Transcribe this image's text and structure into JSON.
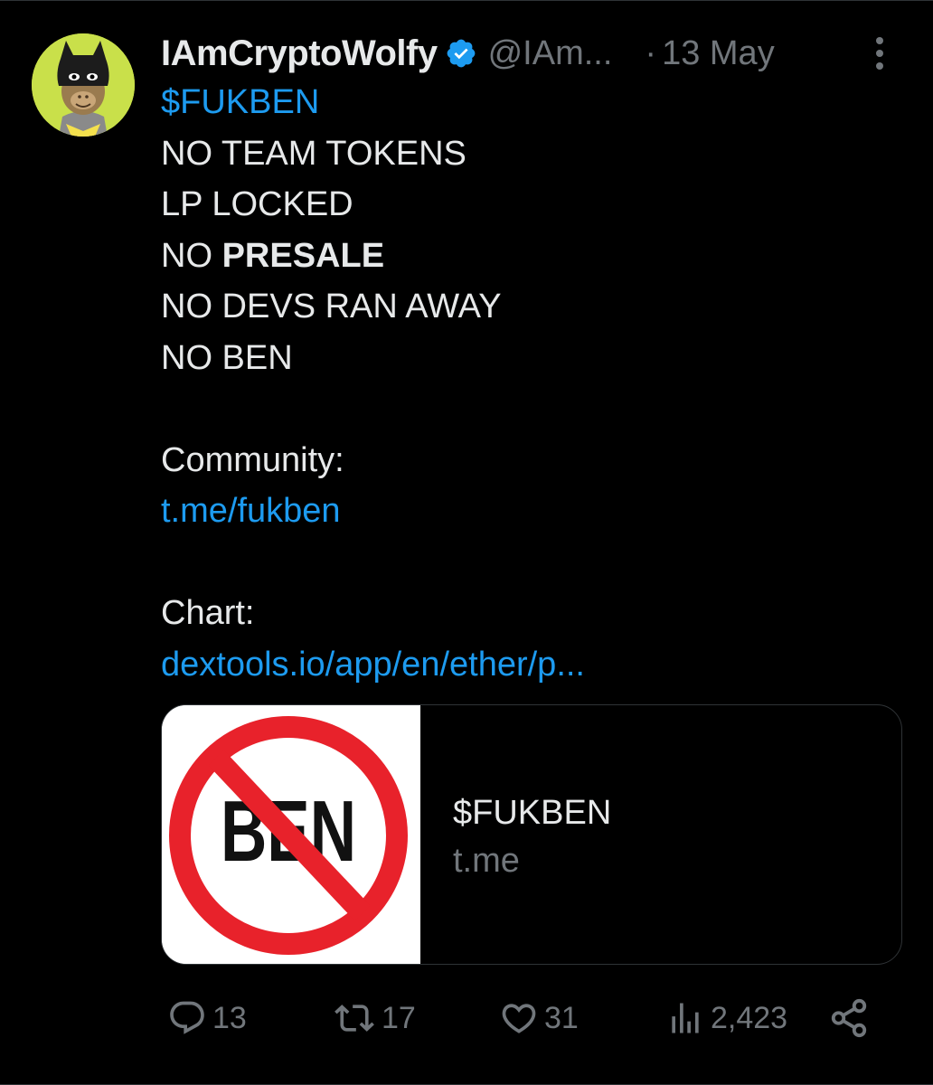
{
  "author": {
    "display_name": "IAmCryptoWolfy",
    "handle": "@IAm...",
    "dot": "·",
    "date": "13 May"
  },
  "tweet": {
    "ticker": "$FUKBEN",
    "line1": "NO TEAM TOKENS",
    "line2": "LP LOCKED",
    "line3_prefix": "NO ",
    "line3_bold": "PRESALE",
    "line4": "NO DEVS RAN AWAY",
    "line5": "NO BEN",
    "community_label": "Community:",
    "community_link": "t.me/fukben",
    "chart_label": "Chart:",
    "chart_link": "dextools.io/app/en/ether/p..."
  },
  "card": {
    "image_text": "BEN",
    "title": "$FUKBEN",
    "domain": "t.me"
  },
  "actions": {
    "replies": "13",
    "reposts": "17",
    "likes": "31",
    "views": "2,423"
  },
  "colors": {
    "background": "#000000",
    "text": "#e7e9ea",
    "muted": "#71767b",
    "link": "#1d9bf0",
    "verified": "#1d9bf0",
    "border": "#2f3336",
    "prohibition_red": "#e8222b"
  },
  "icons": [
    "verified-badge-icon",
    "more-icon",
    "reply-icon",
    "repost-icon",
    "like-icon",
    "views-icon",
    "share-icon"
  ]
}
